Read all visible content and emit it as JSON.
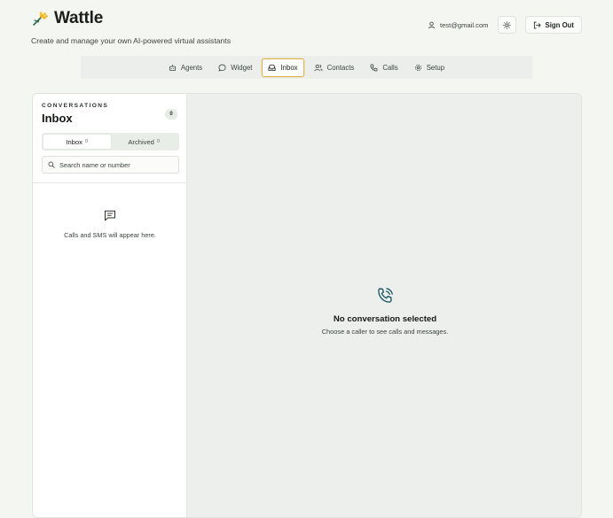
{
  "brand": {
    "name": "Wattle",
    "tagline": "Create and manage your own AI-powered virtual assistants",
    "logo_icon": "wattle-sprig-icon"
  },
  "user": {
    "email": "test@gmail.com",
    "theme_toggle_icon": "sun-icon",
    "sign_out_label": "Sign Out"
  },
  "nav": {
    "items": [
      {
        "label": "Agents",
        "icon": "robot-icon"
      },
      {
        "label": "Widget",
        "icon": "chat-bubble-icon"
      },
      {
        "label": "Inbox",
        "icon": "inbox-icon",
        "active": true
      },
      {
        "label": "Contacts",
        "icon": "users-icon"
      },
      {
        "label": "Calls",
        "icon": "phone-icon"
      },
      {
        "label": "Setup",
        "icon": "gear-icon"
      }
    ]
  },
  "sidebar": {
    "eyebrow": "CONVERSATIONS",
    "title": "Inbox",
    "count": "0",
    "tabs": [
      {
        "label": "Inbox",
        "count": "0",
        "active": true
      },
      {
        "label": "Archived",
        "count": "0"
      }
    ],
    "search": {
      "placeholder": "Search name or number",
      "value": ""
    },
    "empty_message": "Calls and SMS will appear here."
  },
  "detail": {
    "empty_title": "No conversation selected",
    "empty_subtitle": "Choose a caller to see calls and messages."
  },
  "colors": {
    "accent": "#e1b04a",
    "phone_icon": "#1f5a68",
    "background": "#f4f6f2"
  }
}
